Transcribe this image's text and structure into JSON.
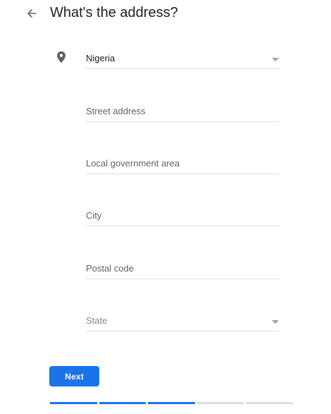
{
  "header": {
    "title": "What's the address?",
    "back_icon": "arrow-back-icon"
  },
  "form": {
    "country": {
      "value": "Nigeria",
      "icon": "location-pin-icon"
    },
    "street_address": {
      "placeholder": "Street address"
    },
    "local_government_area": {
      "placeholder": "Local government area"
    },
    "city": {
      "placeholder": "City"
    },
    "postal_code": {
      "placeholder": "Postal code"
    },
    "state": {
      "placeholder": "State"
    }
  },
  "actions": {
    "next_label": "Next"
  },
  "progress": {
    "completed_steps": 3,
    "total_steps": 5
  },
  "colors": {
    "accent": "#1a73e8",
    "text": "#202124",
    "muted": "#5f6368",
    "divider": "#dadce0"
  }
}
